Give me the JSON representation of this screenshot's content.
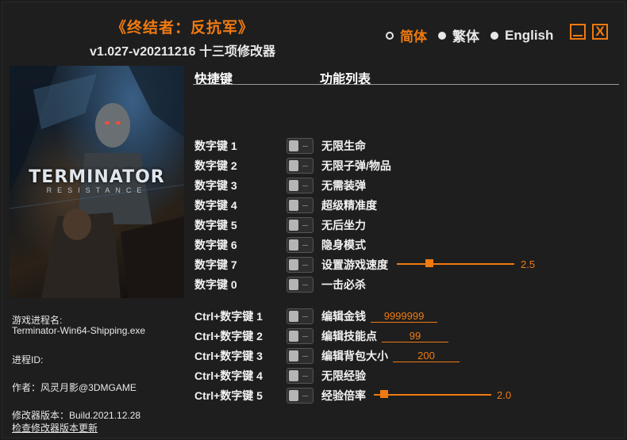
{
  "title": {
    "game": "《终结者：反抗军》",
    "version_line": "v1.027-v20211216 十三项修改器"
  },
  "languages": [
    {
      "label": "简体",
      "selected": true
    },
    {
      "label": "繁体",
      "selected": false
    },
    {
      "label": "English",
      "selected": false
    }
  ],
  "window_buttons": {
    "minimize": "_",
    "close": "X"
  },
  "cover": {
    "logo_text": "TERMINATOR",
    "logo_sub": "RESISTANCE"
  },
  "info": {
    "process_label": "游戏进程名:",
    "process_value": "Terminator-Win64-Shipping.exe",
    "pid_label": "进程ID:",
    "author": "作者：风灵月影@3DMGAME",
    "build": "修改器版本：Build.2021.12.28",
    "update_link": "检查修改器版本更新"
  },
  "headers": {
    "hotkey": "快捷键",
    "functions": "功能列表"
  },
  "cheats": [
    {
      "key": "数字键 1",
      "name": "无限生命"
    },
    {
      "key": "数字键 2",
      "name": "无限子弹/物品"
    },
    {
      "key": "数字键 3",
      "name": "无需装弹"
    },
    {
      "key": "数字键 4",
      "name": "超级精准度"
    },
    {
      "key": "数字键 5",
      "name": "无后坐力"
    },
    {
      "key": "数字键 6",
      "name": "隐身模式"
    },
    {
      "key": "数字键 7",
      "name": "设置游戏速度",
      "slider_value": "2.5",
      "slider_fraction": 0.26
    },
    {
      "key": "数字键 0",
      "name": "一击必杀"
    },
    {
      "key": "Ctrl+数字键 1",
      "name": "编辑金钱",
      "input_value": "9999999"
    },
    {
      "key": "Ctrl+数字键 2",
      "name": "编辑技能点",
      "input_value": "99"
    },
    {
      "key": "Ctrl+数字键 3",
      "name": "编辑背包大小",
      "input_value": "200"
    },
    {
      "key": "Ctrl+数字键 4",
      "name": "无限经验"
    },
    {
      "key": "Ctrl+数字键 5",
      "name": "经验倍率",
      "slider_value": "2.0",
      "slider_fraction": 0.06
    }
  ],
  "colors": {
    "accent": "#f07a10",
    "background": "#1e1e1e",
    "text": "#e8e8e8"
  }
}
